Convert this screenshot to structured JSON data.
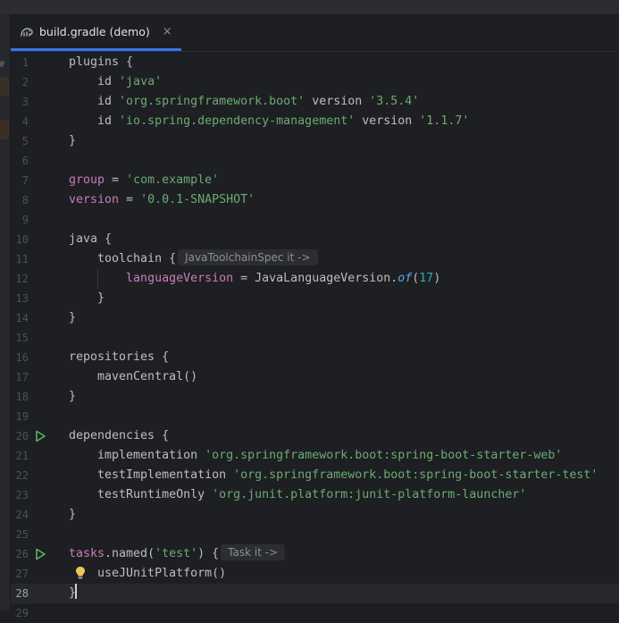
{
  "tab": {
    "label": "build.gradle (demo)",
    "close": "×"
  },
  "left_strip_label": "#",
  "lines": [
    {
      "n": "1",
      "segs": [
        {
          "t": "plugins {"
        }
      ]
    },
    {
      "n": "2",
      "segs": [
        {
          "t": "    id "
        },
        {
          "t": "'java'",
          "c": "str"
        }
      ]
    },
    {
      "n": "3",
      "segs": [
        {
          "t": "    id "
        },
        {
          "t": "'org.springframework.boot'",
          "c": "str"
        },
        {
          "t": " version "
        },
        {
          "t": "'3.5.4'",
          "c": "str"
        }
      ]
    },
    {
      "n": "4",
      "segs": [
        {
          "t": "    id "
        },
        {
          "t": "'io.spring.dependency-management'",
          "c": "str"
        },
        {
          "t": " version "
        },
        {
          "t": "'1.1.7'",
          "c": "str"
        }
      ]
    },
    {
      "n": "5",
      "segs": [
        {
          "t": "}"
        }
      ]
    },
    {
      "n": "6",
      "segs": []
    },
    {
      "n": "7",
      "segs": [
        {
          "t": "group",
          "c": "kw"
        },
        {
          "t": " = "
        },
        {
          "t": "'com.example'",
          "c": "str"
        }
      ]
    },
    {
      "n": "8",
      "segs": [
        {
          "t": "version",
          "c": "kw"
        },
        {
          "t": " = "
        },
        {
          "t": "'0.0.1-SNAPSHOT'",
          "c": "str"
        }
      ]
    },
    {
      "n": "9",
      "segs": []
    },
    {
      "n": "10",
      "segs": [
        {
          "t": "java {"
        }
      ]
    },
    {
      "n": "11",
      "segs": [
        {
          "t": "    toolchain {"
        },
        {
          "hint": "JavaToolchainSpec it ->"
        }
      ]
    },
    {
      "n": "12",
      "guide": true,
      "segs": [
        {
          "t": "        "
        },
        {
          "t": "languageVersion",
          "c": "kw"
        },
        {
          "t": " = JavaLanguageVersion."
        },
        {
          "t": "of",
          "c": "it"
        },
        {
          "t": "("
        },
        {
          "t": "17",
          "c": "num"
        },
        {
          "t": ")"
        }
      ]
    },
    {
      "n": "13",
      "segs": [
        {
          "t": "    }"
        }
      ]
    },
    {
      "n": "14",
      "segs": [
        {
          "t": "}"
        }
      ]
    },
    {
      "n": "15",
      "segs": []
    },
    {
      "n": "16",
      "segs": [
        {
          "t": "repositories {"
        }
      ]
    },
    {
      "n": "17",
      "segs": [
        {
          "t": "    mavenCentral()"
        }
      ]
    },
    {
      "n": "18",
      "segs": [
        {
          "t": "}"
        }
      ]
    },
    {
      "n": "19",
      "segs": []
    },
    {
      "n": "20",
      "run": true,
      "segs": [
        {
          "t": "dependencies {"
        }
      ]
    },
    {
      "n": "21",
      "segs": [
        {
          "t": "    implementation "
        },
        {
          "t": "'org.springframework.boot:spring-boot-starter-web'",
          "c": "str"
        }
      ]
    },
    {
      "n": "22",
      "segs": [
        {
          "t": "    testImplementation "
        },
        {
          "t": "'org.springframework.boot:spring-boot-starter-test'",
          "c": "str"
        }
      ]
    },
    {
      "n": "23",
      "segs": [
        {
          "t": "    testRuntimeOnly "
        },
        {
          "t": "'org.junit.platform:junit-platform-launcher'",
          "c": "str"
        }
      ]
    },
    {
      "n": "24",
      "segs": [
        {
          "t": "}"
        }
      ]
    },
    {
      "n": "25",
      "segs": []
    },
    {
      "n": "26",
      "run": true,
      "segs": [
        {
          "t": "tasks",
          "c": "kw"
        },
        {
          "t": ".named("
        },
        {
          "t": "'test'",
          "c": "str"
        },
        {
          "t": ") {"
        },
        {
          "hint": "Task it ->"
        }
      ]
    },
    {
      "n": "27",
      "bulb": true,
      "segs": [
        {
          "t": "    useJUnitPlatform()"
        }
      ]
    },
    {
      "n": "28",
      "current": true,
      "segs": [
        {
          "t": "}"
        },
        {
          "caret": true
        }
      ]
    },
    {
      "n": "29",
      "segs": []
    }
  ]
}
